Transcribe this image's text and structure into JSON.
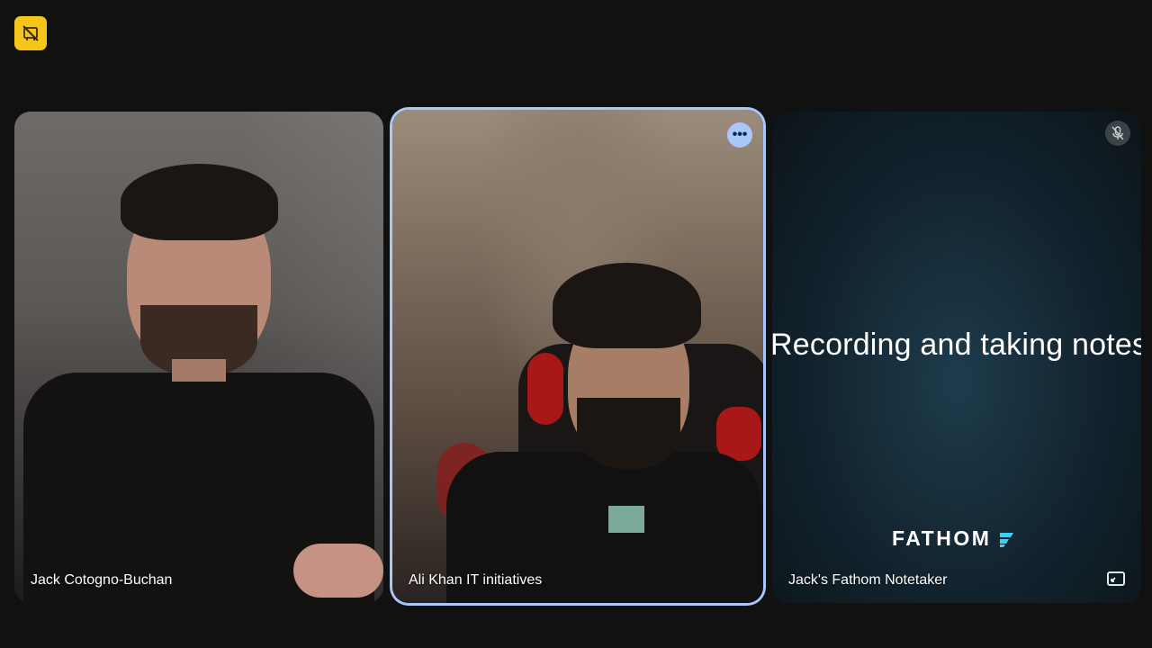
{
  "recording_badge": {
    "icon": "recording-off-icon",
    "color": "#f5c518"
  },
  "participants": [
    {
      "name": "Jack Cotogno-Buchan"
    },
    {
      "name": "Ali Khan IT initiatives",
      "more_icon": "more-horiz-icon",
      "more_label": "•••"
    },
    {
      "name": "Jack's Fathom Notetaker",
      "status_icon": "mic-off-icon",
      "expand_icon": "expand-icon"
    }
  ],
  "fathom_tile": {
    "message": "Recording and taking notes",
    "logo_text": "FATHOM"
  },
  "colors": {
    "background": "#111111",
    "active_border": "#a8c7fa",
    "fathom_accent": "#3fd0f0"
  }
}
